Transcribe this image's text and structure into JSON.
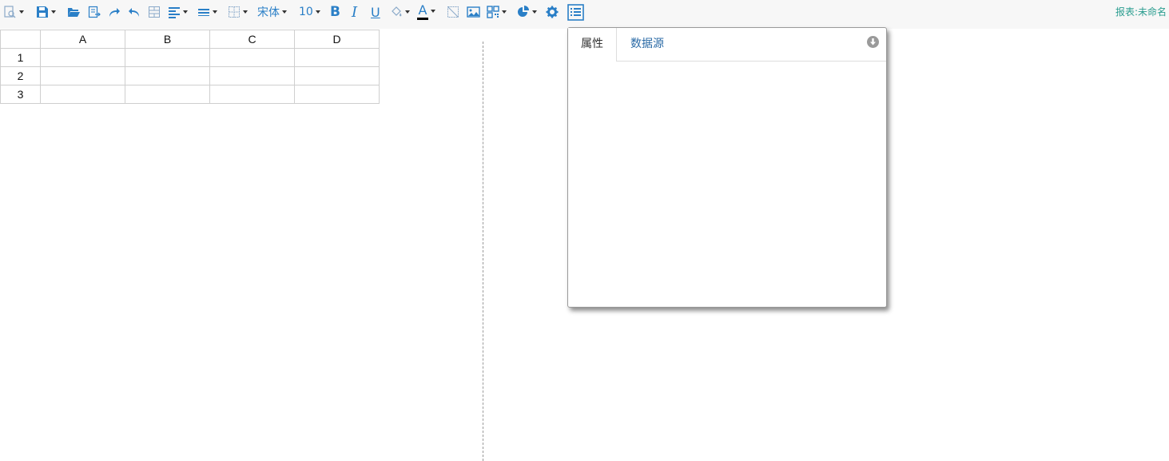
{
  "toolbar": {
    "font_name": "宋体",
    "font_size": "10",
    "bold_label": "B",
    "italic_label": "I",
    "underline_label": "U",
    "font_color_label": "A",
    "accent_color": "#2a7fc7",
    "icons": [
      "preview-icon",
      "save-icon",
      "open-folder-icon",
      "export-icon",
      "redo-icon",
      "undo-icon",
      "merge-cells-icon",
      "align-icon",
      "valign-icon",
      "border-icon",
      "font-family-dropdown",
      "font-size-dropdown",
      "bold-icon",
      "italic-icon",
      "underline-icon",
      "fill-color-icon",
      "font-color-icon",
      "clear-format-icon",
      "image-icon",
      "qrcode-icon",
      "chart-icon",
      "settings-icon",
      "list-panel-icon"
    ]
  },
  "report_label": "报表:未命名",
  "sheet": {
    "columns": [
      "A",
      "B",
      "C",
      "D"
    ],
    "rows": [
      "1",
      "2",
      "3"
    ]
  },
  "panel": {
    "tabs": [
      "属性",
      "数据源"
    ],
    "active_tab": "属性"
  }
}
